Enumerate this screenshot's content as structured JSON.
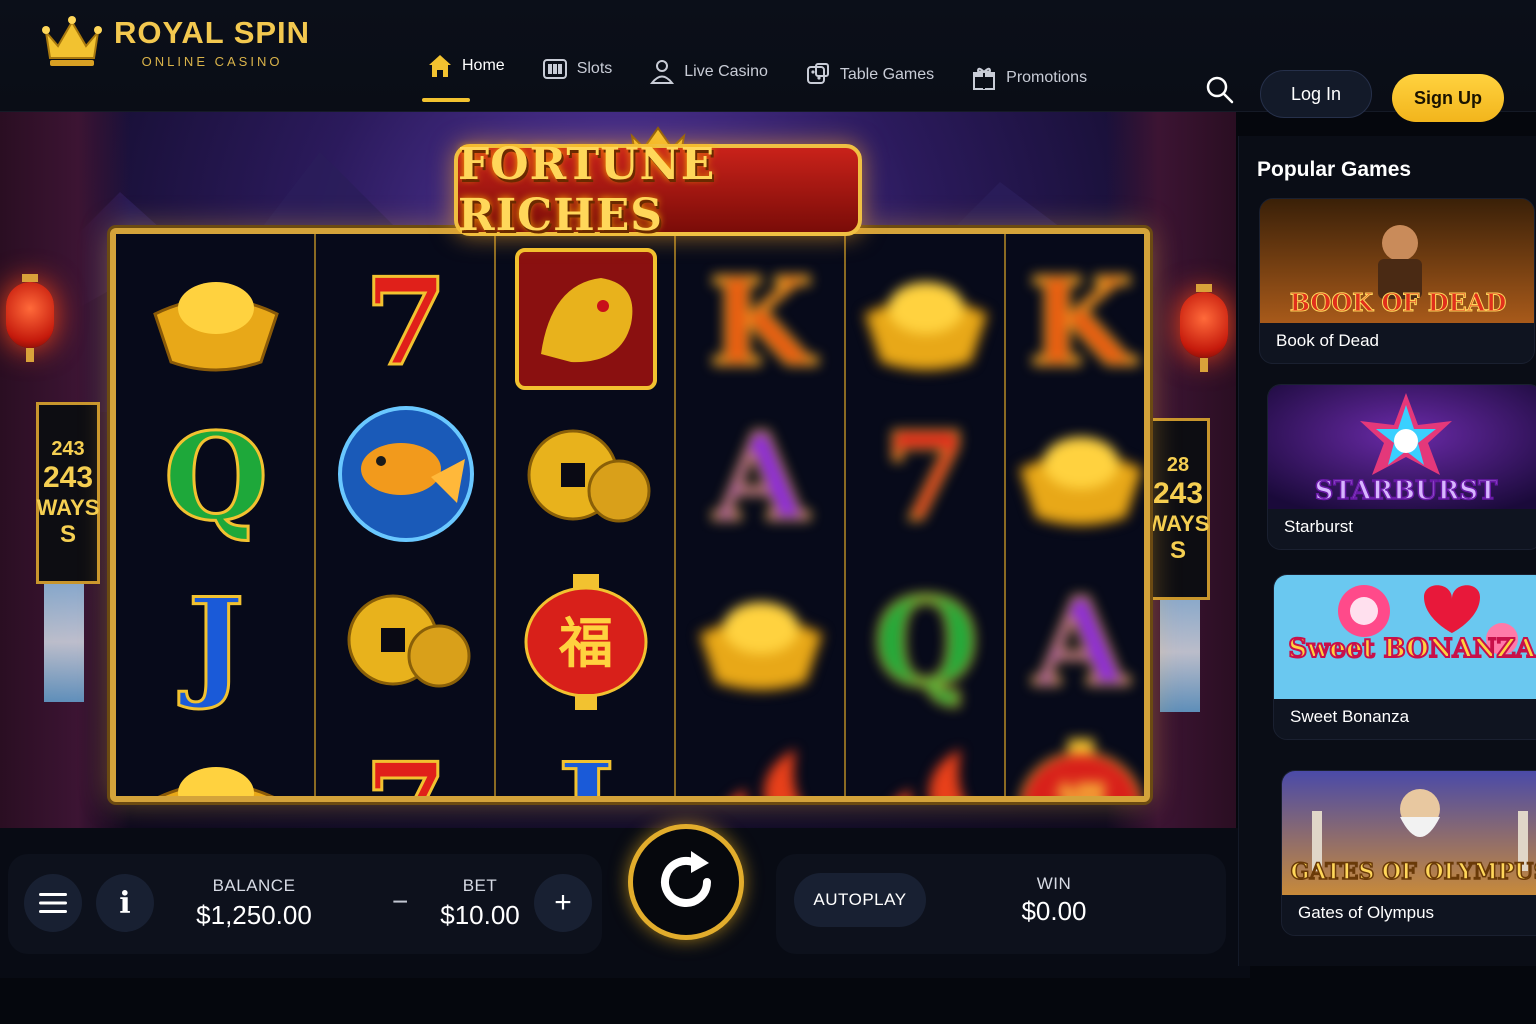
{
  "brand": {
    "title": "ROYAL SPIN",
    "subtitle": "ONLINE CASINO",
    "accent": "#f2c230"
  },
  "nav": {
    "items": [
      {
        "label": "Home",
        "icon": "home-icon",
        "active": true
      },
      {
        "label": "Slots",
        "icon": "slots-icon"
      },
      {
        "label": "Live Casino",
        "icon": "live-dealer-icon"
      },
      {
        "label": "Table Games",
        "icon": "dice-icon"
      },
      {
        "label": "Promotions",
        "icon": "gift-icon"
      }
    ]
  },
  "auth": {
    "login": "Log In",
    "signup": "Sign Up"
  },
  "game": {
    "title": "FORTUNE RICHES",
    "ways_left": [
      "243",
      "243",
      "WAYS",
      "S"
    ],
    "ways_right": [
      "28",
      "243",
      "WAYS",
      "S"
    ],
    "reels": [
      {
        "symbols": [
          "gold-ingot",
          "Q",
          "J",
          "gold-ingot"
        ],
        "spinning": false
      },
      {
        "symbols": [
          "7",
          "koi-fish",
          "coins",
          "7"
        ],
        "spinning": false
      },
      {
        "symbols": [
          "dragon",
          "coins",
          "lantern",
          "J"
        ],
        "spinning": false
      },
      {
        "symbols": [
          "K",
          "A",
          "gold-ingot",
          "fire"
        ],
        "spinning": true
      },
      {
        "symbols": [
          "gold-ingot",
          "7",
          "Q",
          "fire"
        ],
        "spinning": true
      },
      {
        "symbols": [
          "K",
          "gold-ingot",
          "A",
          "lantern"
        ],
        "spinning": true
      }
    ],
    "lantern_glyph": "福"
  },
  "controls": {
    "balance_label": "BALANCE",
    "balance_value": "$1,250.00",
    "bet_label": "BET",
    "bet_value": "$10.00",
    "minus": "−",
    "plus": "+",
    "autoplay": "AUTOPLAY",
    "win_label": "WIN",
    "win_value": "$0.00",
    "info": "i"
  },
  "sidebar": {
    "title": "Popular Games",
    "games": [
      {
        "name": "Book of Dead",
        "art_text": "BOOK OF DEAD"
      },
      {
        "name": "Starburst",
        "art_text": "STARBURST"
      },
      {
        "name": "Sweet Bonanza",
        "art_text": "Sweet BONANZA"
      },
      {
        "name": "Gates of Olympus",
        "art_text": "GATES OF OLYMPUS"
      }
    ]
  }
}
